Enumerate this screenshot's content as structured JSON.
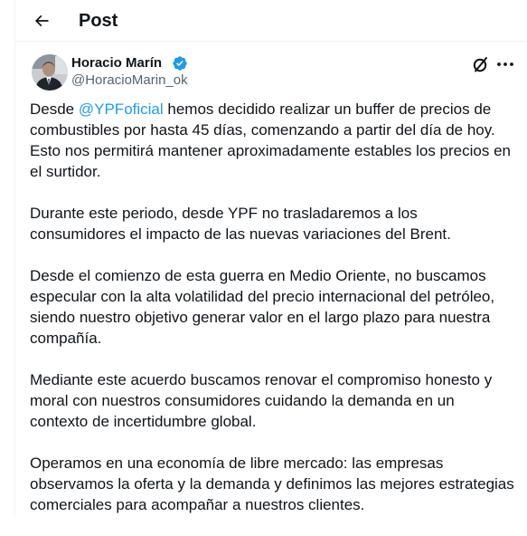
{
  "header": {
    "back_icon": "arrow-left-icon",
    "title": "Post"
  },
  "author": {
    "name": "Horacio Marín",
    "handle": "@HoracioMarin_ok",
    "verified_color": "#1d9bf0"
  },
  "tweet": {
    "mention_color": "#1d9bf0",
    "p1": {
      "lead": "Desde ",
      "mention": "@YPFoficial",
      "rest": " hemos decidido realizar un buffer de precios de combustibles por hasta 45 días, comenzando a partir del día de hoy. Esto nos permitirá mantener aproximadamente estables los precios en el surtidor."
    },
    "p2": "Durante este periodo, desde YPF no trasladaremos a los consumidores el impacto de las nuevas variaciones del Brent.",
    "p3": "Desde el comienzo de esta guerra en Medio Oriente, no buscamos especular con la alta volatilidad del precio internacional del petróleo, siendo nuestro objetivo generar valor en el largo plazo para nuestra compañía.",
    "p4": "Mediante este acuerdo buscamos renovar el compromiso honesto y moral con nuestros consumidores cuidando la demanda en un contexto de incertidumbre global.",
    "p5": "Operamos en una economía de libre mercado: las empresas observamos la oferta y la demanda y definimos las mejores estrategias comerciales para acompañar a nuestros clientes."
  }
}
